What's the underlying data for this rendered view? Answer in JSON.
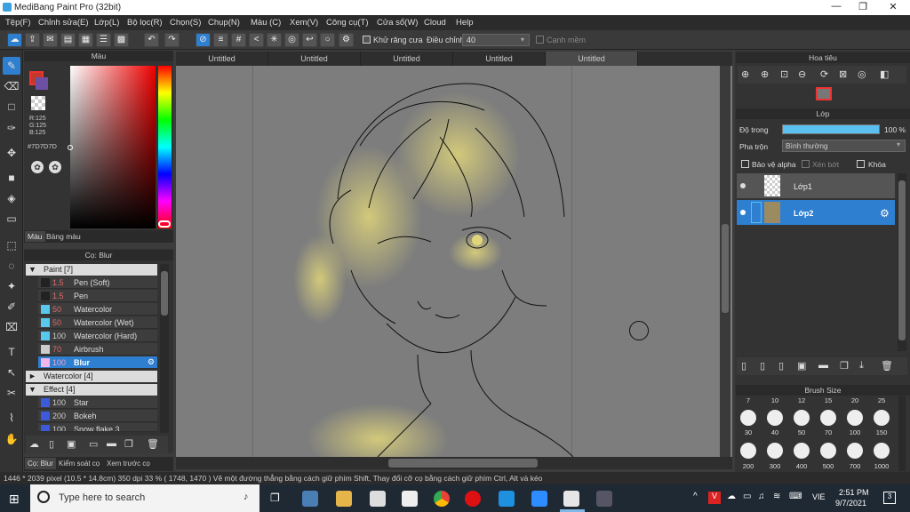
{
  "window": {
    "title": "MediBang Paint Pro (32bit)",
    "min": "—",
    "max": "❐",
    "close": "✕"
  },
  "menu": [
    "Tệp(F)",
    "Chỉnh sửa(E)",
    "Lớp(L)",
    "Bộ lọc(R)",
    "Chọn(S)",
    "Chụp(N)",
    "Màu (C)",
    "Xem(V)",
    "Công cụ(T)",
    "Cửa sổ(W)",
    "Cloud",
    "Help"
  ],
  "toolbar": {
    "antialias_label": "Khử răng cưa",
    "adjust_label": "Điều chỉnh",
    "adjust_value": "40",
    "edge_label": "Cạnh mềm"
  },
  "color_panel": {
    "title": "Màu",
    "r": "R:125",
    "g": "G:125",
    "b": "B:125",
    "hex": "#7D7D7D",
    "tab_color": "Màu",
    "tab_palette": "Bảng màu",
    "primary": "#c0392b",
    "secondary": "#6d4fa3"
  },
  "brush_panel": {
    "title": "Cọ: Blur",
    "groups": [
      {
        "label": "Paint [7]",
        "arrow": "▼"
      },
      {
        "label": "Watercolor [4]",
        "arrow": "►"
      },
      {
        "label": "Effect [4]",
        "arrow": "▼"
      }
    ],
    "paint": [
      {
        "size": "1.5",
        "name": "Pen (Soft)",
        "color": "#222222"
      },
      {
        "size": "1.5",
        "name": "Pen",
        "color": "#222222"
      },
      {
        "size": "50",
        "name": "Watercolor",
        "color": "#5ac8ec"
      },
      {
        "size": "50",
        "name": "Watercolor (Wet)",
        "color": "#5ac8ec"
      },
      {
        "size": "100",
        "name": "Watercolor (Hard)",
        "color": "#5ac8ec"
      },
      {
        "size": "70",
        "name": "Airbrush",
        "color": "#cccccc"
      },
      {
        "size": "100",
        "name": "Blur",
        "color": "#f3b6e8"
      }
    ],
    "effect": [
      {
        "size": "100",
        "name": "Star",
        "color": "#3b5bdb"
      },
      {
        "size": "200",
        "name": "Bokeh",
        "color": "#3b5bdb"
      },
      {
        "size": "100",
        "name": "Snow flake 3",
        "color": "#3b5bdb"
      }
    ],
    "tab_brush": "Cọ: Blur",
    "tab_control": "Kiểm soát cọ",
    "tab_preview": "Xem trước cọ"
  },
  "tabs": [
    "Untitled",
    "Untitled",
    "Untitled",
    "Untitled",
    "Untitled"
  ],
  "navigator": {
    "title": "Hoa tiêu"
  },
  "layer_panel": {
    "title": "Lớp",
    "opacity_label": "Độ trong",
    "opacity_value": "100 %",
    "blend_label": "Pha trộn",
    "blend_value": "Bình thường",
    "protect_alpha": "Bảo vệ alpha",
    "clip": "Xén bớt",
    "lock": "Khóa",
    "layers": [
      {
        "name": "Lớp1"
      },
      {
        "name": "Lớp2"
      }
    ]
  },
  "brush_size": {
    "title": "Brush Size",
    "top": [
      "7",
      "10",
      "12",
      "15",
      "20",
      "25"
    ],
    "mid": [
      "30",
      "40",
      "50",
      "70",
      "100",
      "150"
    ],
    "bottom": [
      "200",
      "300",
      "400",
      "500",
      "700",
      "1000"
    ]
  },
  "status": {
    "text": "1446 * 2039 pixel   (10.5 * 14.8cm)   350 dpi   33 %   ( 1748, 1470 )   Vẽ một đường thẳng bằng cách giữ phím Shift, Thay đổi cỡ cọ bằng cách giữ phím Ctrl, Alt và kéo"
  },
  "taskbar": {
    "search": "Type here to search",
    "lang": "VIE",
    "time": "2:51 PM",
    "date": "9/7/2021",
    "notif": "3"
  }
}
